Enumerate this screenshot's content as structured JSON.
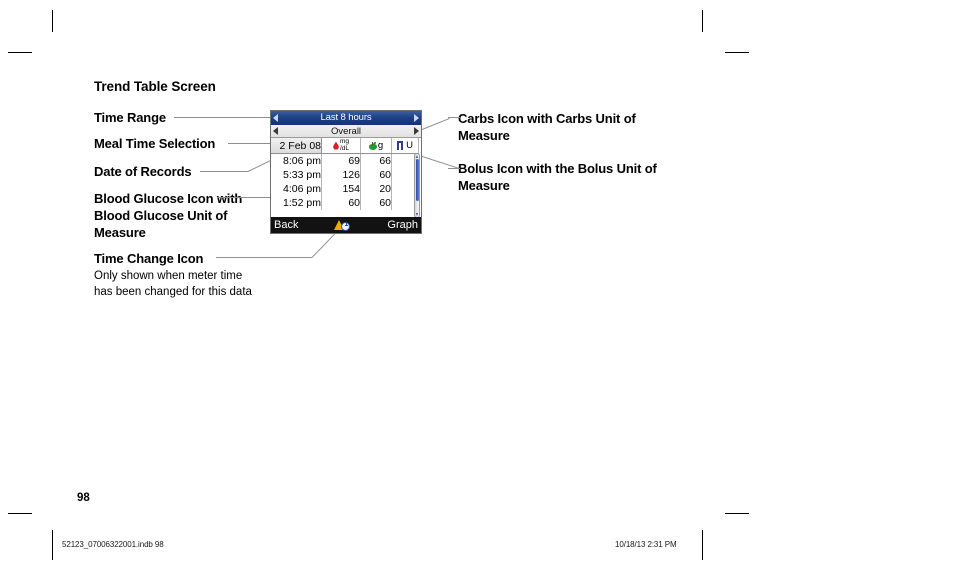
{
  "page": {
    "title": "Trend Table Screen",
    "number": "98",
    "footer_left": "52123_07006322001.indb   98",
    "footer_right": "10/18/13   2:31 PM"
  },
  "callouts": {
    "left": [
      {
        "id": "time-range",
        "label": "Time Range"
      },
      {
        "id": "meal-time",
        "label": "Meal Time Selection"
      },
      {
        "id": "date-records",
        "label": "Date of Records"
      },
      {
        "id": "bg-icon",
        "label": "Blood Glucose Icon with Blood Glucose Unit of Measure"
      },
      {
        "id": "time-change",
        "label": "Time Change Icon",
        "sub": "Only shown when meter time has been changed for this data"
      }
    ],
    "right": [
      {
        "id": "carbs-icon",
        "label": "Carbs Icon with Carbs Unit of Measure"
      },
      {
        "id": "bolus-icon",
        "label": "Bolus Icon with the Bolus Unit of Measure"
      }
    ]
  },
  "device": {
    "time_range": {
      "label": "Last 8 hours",
      "prev_icon": "triangle-left-icon",
      "next_icon": "triangle-right-icon"
    },
    "meal_time": {
      "label": "Overall",
      "prev_icon": "triangle-left-icon",
      "next_icon": "triangle-right-icon"
    },
    "table": {
      "headers": {
        "date": "2 Feb 08",
        "bg_icon": "blood-drop-icon",
        "bg_unit_top": "mg",
        "bg_unit_bottom": "/dL",
        "carbs_icon": "apple-icon",
        "carbs_unit": "g",
        "bolus_icon": "bolus-icon",
        "bolus_unit": "U"
      },
      "rows": [
        {
          "time": "8:06 pm",
          "bg": "69",
          "carbs": "66",
          "bolus": ""
        },
        {
          "time": "5:33 pm",
          "bg": "126",
          "carbs": "60",
          "bolus": ""
        },
        {
          "time": "4:06 pm",
          "bg": "154",
          "carbs": "20",
          "bolus": ""
        },
        {
          "time": "1:52 pm",
          "bg": "60",
          "carbs": "60",
          "bolus": ""
        }
      ]
    },
    "bottom_bar": {
      "back_label": "Back",
      "time_change_icon": "time-change-warning-clock-icon",
      "graph_label": "Graph"
    },
    "scrollbar": {
      "up_icon": "scroll-up-arrow-icon",
      "down_icon": "scroll-down-arrow-icon"
    }
  },
  "colors": {
    "title_bar_blue": "#1d3f85",
    "bg_icon_red": "#d81f26",
    "carbs_icon_green": "#1f9c33",
    "bolus_icon_blue": "#2c3f8c",
    "time_change_orange": "#f0a800",
    "bottom_bar_black": "#121212"
  }
}
